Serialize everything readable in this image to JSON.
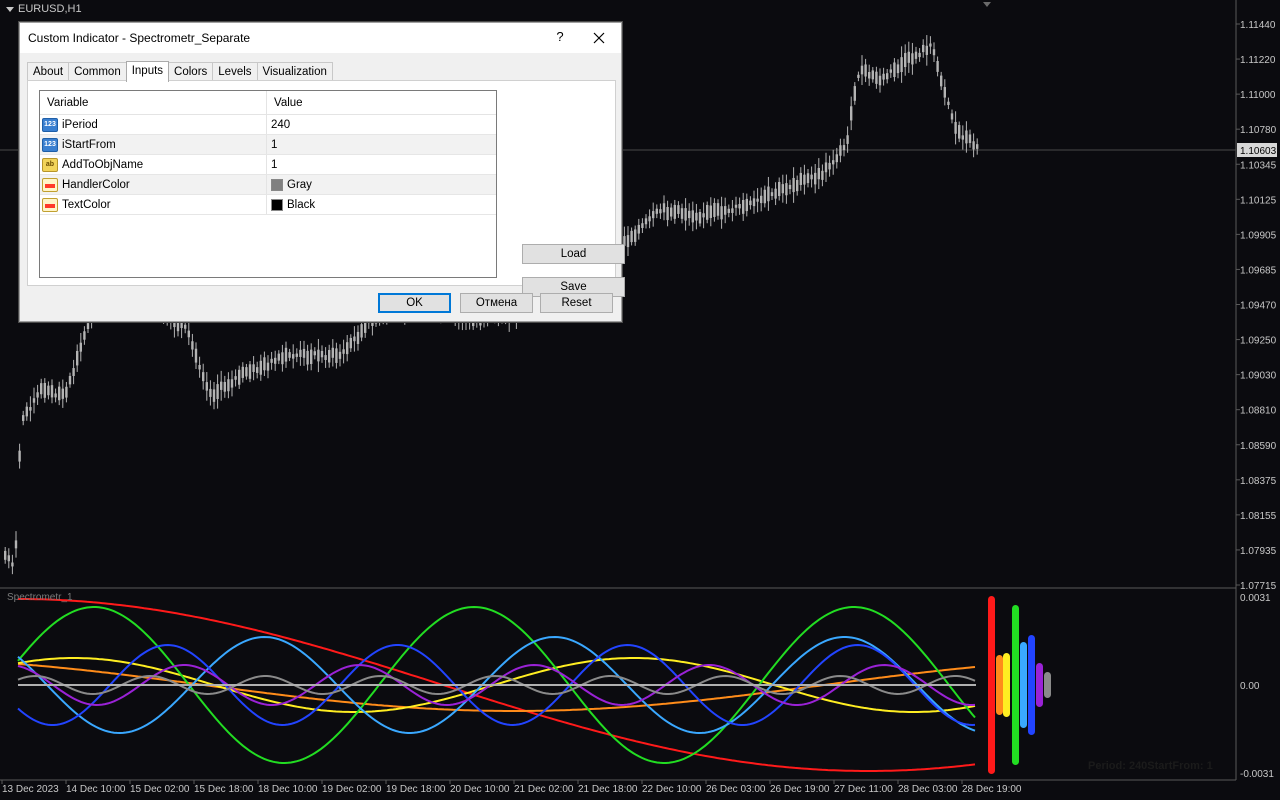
{
  "symbol": "EURUSD,H1",
  "price_axis": [
    "1.11440",
    "1.11220",
    "1.11000",
    "1.10780",
    "1.10345",
    "1.10125",
    "1.09905",
    "1.09685",
    "1.09470",
    "1.09250",
    "1.09030",
    "1.08810",
    "1.08590",
    "1.08375",
    "1.08155",
    "1.07935",
    "1.07715"
  ],
  "current_price": "1.10603",
  "indicator_axis": [
    "0.0031",
    "0.00",
    "-0.0031"
  ],
  "indicator_title": "Spectrometr_1",
  "indicator_overlay": "Period: 240StartFrom: 1",
  "time_axis": [
    "13 Dec 2023",
    "14 Dec 10:00",
    "15 Dec 02:00",
    "15 Dec 18:00",
    "18 Dec 10:00",
    "19 Dec 02:00",
    "19 Dec 18:00",
    "20 Dec 10:00",
    "21 Dec 02:00",
    "21 Dec 18:00",
    "22 Dec 10:00",
    "26 Dec 03:00",
    "26 Dec 19:00",
    "27 Dec 11:00",
    "28 Dec 03:00",
    "28 Dec 19:00"
  ],
  "colors": {
    "background": "#0b0b0f",
    "candle": "#b4b4b4",
    "separator": "#5a5a5a",
    "text": "#c8c8c8",
    "current_price_bg": "#d8d8d8",
    "spectrum": [
      "#ff1a1a",
      "#ff8c1a",
      "#ffee22",
      "#22dd22",
      "#3aa8ff",
      "#2244ff",
      "#9a22d6",
      "#8a8a8a"
    ]
  },
  "dialog": {
    "title": "Custom Indicator - Spectrometr_Separate",
    "help": "?",
    "tabs": [
      "About",
      "Common",
      "Inputs",
      "Colors",
      "Levels",
      "Visualization"
    ],
    "active_tab": "Inputs",
    "columns": {
      "variable": "Variable",
      "value": "Value"
    },
    "rows": [
      {
        "type": "num",
        "icon": "number-icon",
        "name": "iPeriod",
        "value": "240"
      },
      {
        "type": "num",
        "icon": "number-icon",
        "name": "iStartFrom",
        "value": "1"
      },
      {
        "type": "str",
        "icon": "string-icon",
        "name": "AddToObjName",
        "value": "1"
      },
      {
        "type": "clr",
        "icon": "color-icon",
        "name": "HandlerColor",
        "value": "Gray",
        "swatch": "#808080"
      },
      {
        "type": "clr",
        "icon": "color-icon",
        "name": "TextColor",
        "value": "Black",
        "swatch": "#000000"
      }
    ],
    "buttons": {
      "load": "Load",
      "save": "Save",
      "ok": "OK",
      "cancel": "Отмена",
      "reset": "Reset"
    }
  }
}
